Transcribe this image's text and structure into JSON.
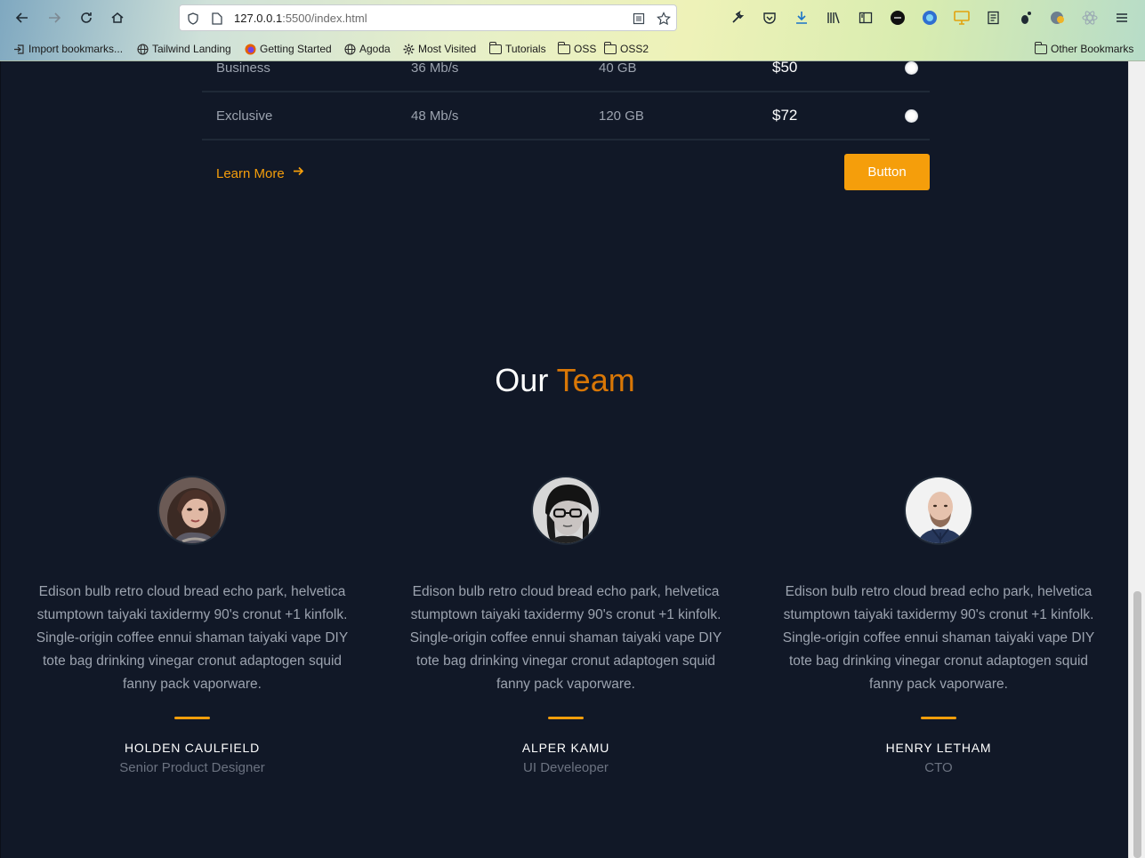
{
  "browser": {
    "url_host": "127.0.0.1",
    "url_path": ":5500/index.html",
    "bookmarks": [
      {
        "label": "Import bookmarks...",
        "icon": "import-icon"
      },
      {
        "label": "Tailwind Landing",
        "icon": "globe-icon"
      },
      {
        "label": "Getting Started",
        "icon": "firefox-icon"
      },
      {
        "label": "Agoda",
        "icon": "globe-icon"
      },
      {
        "label": "Most Visited",
        "icon": "gear-icon"
      },
      {
        "label": "Tutorials",
        "icon": "folder-icon"
      },
      {
        "label": "OSS",
        "icon": "folder-icon"
      },
      {
        "label": "OSS2",
        "icon": "folder-icon"
      }
    ],
    "other_bookmarks": "Other Bookmarks"
  },
  "pricing": {
    "rows": [
      {
        "plan": "Business",
        "speed": "36 Mb/s",
        "storage": "40 GB",
        "price": "$50"
      },
      {
        "plan": "Exclusive",
        "speed": "48 Mb/s",
        "storage": "120 GB",
        "price": "$72"
      }
    ],
    "learn_more": "Learn More",
    "button": "Button"
  },
  "team": {
    "title_part1": "Our",
    "title_part2": "Team",
    "members": [
      {
        "name": "HOLDEN CAULFIELD",
        "role": "Senior Product Designer",
        "bio": "Edison bulb retro cloud bread echo park, helvetica stumptown taiyaki taxidermy 90's cronut +1 kinfolk. Single-origin coffee ennui shaman taiyaki vape DIY tote bag drinking vinegar cronut adaptogen squid fanny pack vaporware."
      },
      {
        "name": "ALPER KAMU",
        "role": "UI Develeoper",
        "bio": "Edison bulb retro cloud bread echo park, helvetica stumptown taiyaki taxidermy 90's cronut +1 kinfolk. Single-origin coffee ennui shaman taiyaki vape DIY tote bag drinking vinegar cronut adaptogen squid fanny pack vaporware."
      },
      {
        "name": "HENRY LETHAM",
        "role": "CTO",
        "bio": "Edison bulb retro cloud bread echo park, helvetica stumptown taiyaki taxidermy 90's cronut +1 kinfolk. Single-origin coffee ennui shaman taiyaki vape DIY tote bag drinking vinegar cronut adaptogen squid fanny pack vaporware."
      }
    ]
  },
  "colors": {
    "background": "#111827",
    "accent": "#f59e0b",
    "title_accent": "#d97706",
    "muted_text": "#9ca3af"
  }
}
